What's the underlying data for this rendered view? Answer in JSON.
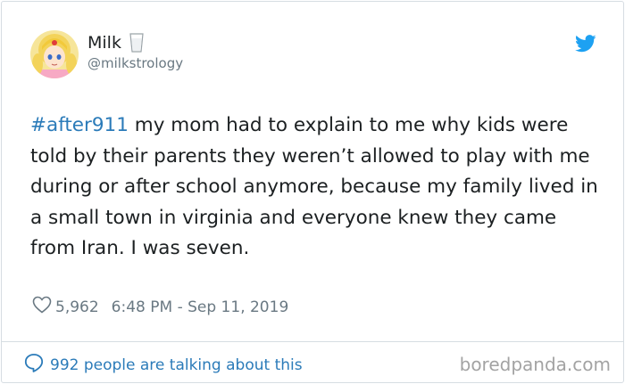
{
  "author": {
    "display_name": "Milk",
    "handle": "@milkstrology",
    "avatar_icon": "anime-character-avatar",
    "name_emoji_icon": "glass-of-milk-icon"
  },
  "tweet": {
    "hashtag": "#after911",
    "body": " my mom had to explain to me why kids were told by their parents they weren’t allowed to play with me during or after school anymore, because my family lived in a small town in virginia and everyone knew they came from Iran. I was seven."
  },
  "meta": {
    "likes": "5,962",
    "timestamp": "6:48 PM - Sep 11, 2019"
  },
  "footer": {
    "talking_label": "992 people are talking about this",
    "watermark": "boredpanda.com"
  },
  "colors": {
    "link": "#2b7bb9",
    "twitter_blue": "#1da1f2",
    "muted": "#697882",
    "text": "#1c2022"
  }
}
